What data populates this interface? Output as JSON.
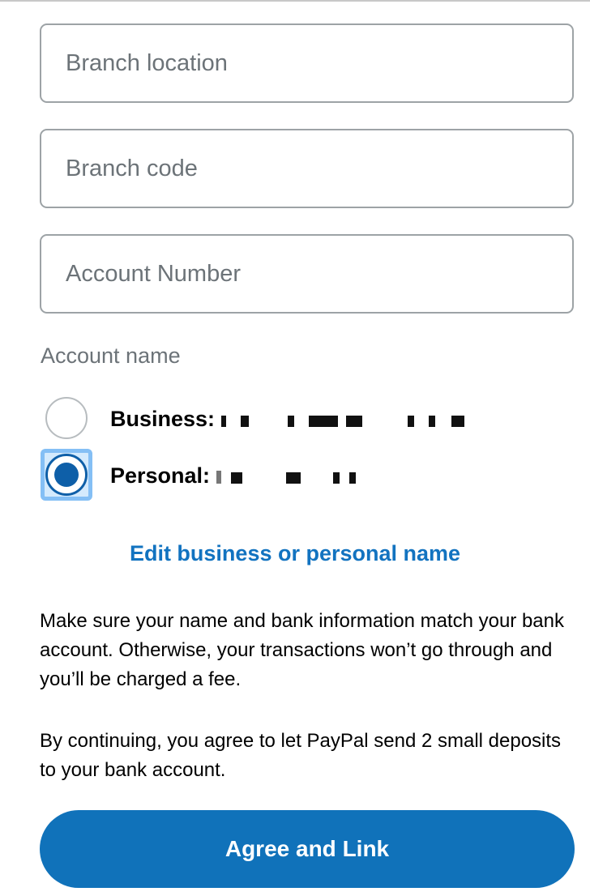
{
  "form": {
    "branch_location": {
      "placeholder": "Branch location",
      "value": ""
    },
    "branch_code": {
      "placeholder": "Branch code",
      "value": ""
    },
    "account_number": {
      "placeholder": "Account Number",
      "value": ""
    }
  },
  "account_name": {
    "label": "Account name",
    "options": [
      {
        "label": "Business:",
        "value": "[redacted]",
        "selected": false
      },
      {
        "label": "Personal:",
        "value": "[redacted]",
        "selected": true
      }
    ]
  },
  "edit_link": {
    "label": "Edit business or personal name"
  },
  "info": {
    "match_notice": "Make sure your name and bank information match your bank account. Otherwise, your transactions won’t go through and you’ll be charged a fee.",
    "deposit_notice": "By continuing, you agree to let PayPal send 2 small deposits to your bank account."
  },
  "actions": {
    "agree_button": "Agree and Link"
  },
  "colors": {
    "accent": "#1072ba",
    "link": "#1273c0",
    "radio_selected": "#0e5fa8",
    "placeholder": "#6c7378",
    "border": "#9da3a6"
  }
}
